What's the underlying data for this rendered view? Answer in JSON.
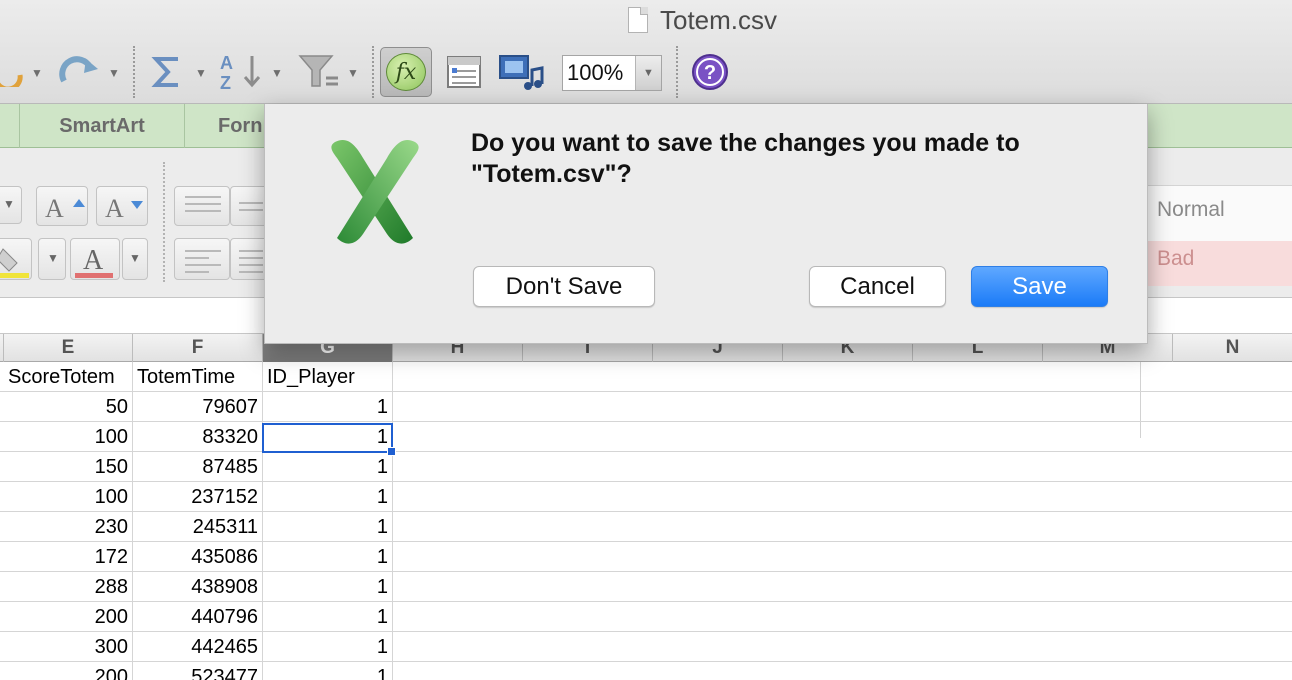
{
  "window": {
    "title": "Totem.csv"
  },
  "toolbar": {
    "zoom": "100%",
    "formula_glyph": "fx",
    "help_glyph": "?"
  },
  "ribbon": {
    "tabs": [
      "SmartArt",
      "Forn"
    ],
    "format_label": "ormat",
    "style_normal": "Normal",
    "style_bad": "Bad"
  },
  "grid": {
    "columns": [
      "E",
      "F",
      "G",
      "H",
      "I",
      "J",
      "K",
      "L",
      "M",
      "N"
    ],
    "active_column": "G",
    "header_row": [
      "ScoreTotem",
      "TotemTime",
      "ID_Player"
    ],
    "rows": [
      [
        "50",
        "79607",
        "1"
      ],
      [
        "100",
        "83320",
        "1"
      ],
      [
        "150",
        "87485",
        "1"
      ],
      [
        "100",
        "237152",
        "1"
      ],
      [
        "230",
        "245311",
        "1"
      ],
      [
        "172",
        "435086",
        "1"
      ],
      [
        "288",
        "438908",
        "1"
      ],
      [
        "200",
        "440796",
        "1"
      ],
      [
        "300",
        "442465",
        "1"
      ],
      [
        "200",
        "523477",
        "1"
      ]
    ]
  },
  "dialog": {
    "message": "Do you want to save the changes you made to \"Totem.csv\"?",
    "dont_save": "Don't Save",
    "cancel": "Cancel",
    "save": "Save",
    "accent_color": "#1b7bf7"
  },
  "colors": {
    "ribbon_tab_bg": "#cfe5c7",
    "selection": "#1f5fd1"
  }
}
